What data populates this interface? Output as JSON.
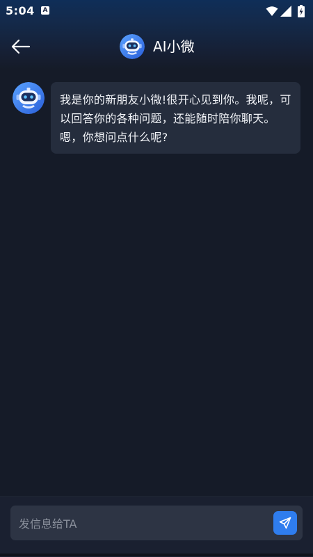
{
  "status_bar": {
    "time": "5:04",
    "notification_icon": "a-letter-icon",
    "icons": [
      "wifi-icon",
      "signal-icon",
      "battery-charging-icon"
    ]
  },
  "header": {
    "back_icon": "arrow-left-icon",
    "avatar_icon": "robot-avatar-icon",
    "title": "AI小微"
  },
  "chat": {
    "messages": [
      {
        "sender_avatar": "robot-avatar-icon",
        "text": "我是你的新朋友小微!很开心见到你。我呢，可以回答你的各种问题，还能随时陪你聊天。嗯，你想问点什么呢?"
      }
    ]
  },
  "composer": {
    "placeholder": "发信息给TA",
    "value": "",
    "send_icon": "send-icon"
  },
  "colors": {
    "background": "#151b28",
    "bubble": "#252d3d",
    "accent": "#2f7dee",
    "input": "#2d3444"
  }
}
